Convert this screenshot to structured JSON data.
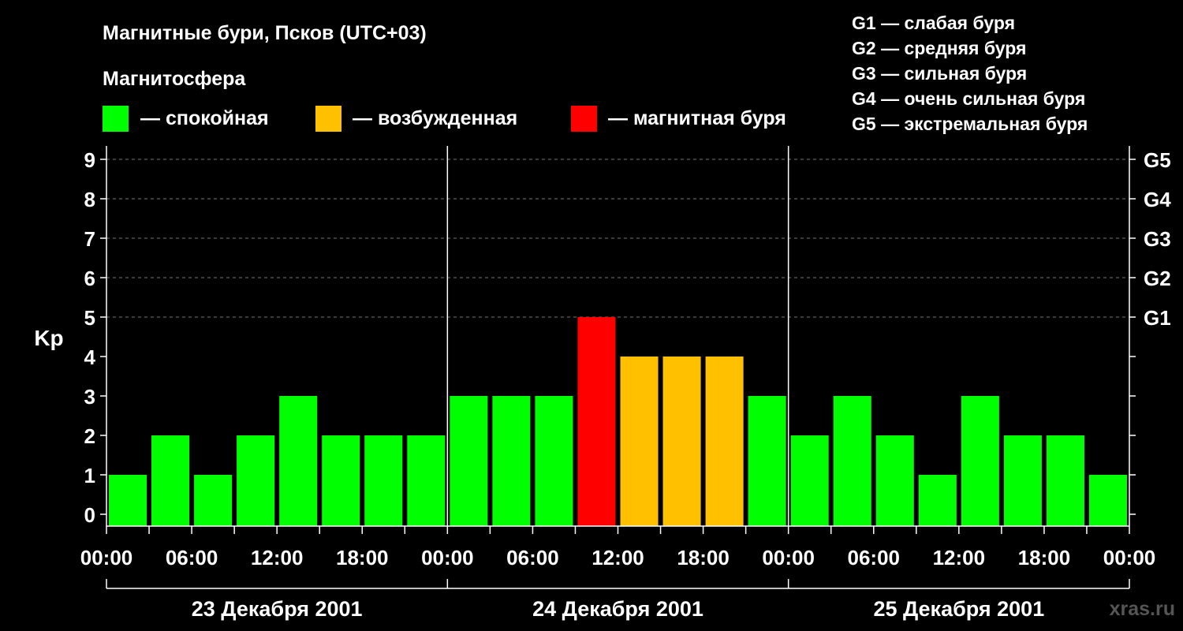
{
  "header": {
    "title": "Магнитные бури, Псков (UTC+03)",
    "magnetosphere_label": "Магнитосфера",
    "legend": [
      {
        "label": "— спокойная",
        "color": "#00ff00"
      },
      {
        "label": "— возбужденная",
        "color": "#ffc000"
      },
      {
        "label": "— магнитная буря",
        "color": "#ff0000"
      }
    ],
    "g_scale": [
      "G1 — слабая буря",
      "G2 — средняя буря",
      "G3 — сильная буря",
      "G4 — очень сильная буря",
      "G5 — экстремальная буря"
    ]
  },
  "watermark": "xras.ru",
  "chart_data": {
    "type": "bar",
    "ylabel": "Kp",
    "ylim": [
      0,
      9
    ],
    "y_ticks": [
      "0",
      "1",
      "2",
      "3",
      "4",
      "5",
      "6",
      "7",
      "8",
      "9"
    ],
    "right_ticks": [
      {
        "kp": 5,
        "label": "G1"
      },
      {
        "kp": 6,
        "label": "G2"
      },
      {
        "kp": 7,
        "label": "G3"
      },
      {
        "kp": 8,
        "label": "G4"
      },
      {
        "kp": 9,
        "label": "G5"
      }
    ],
    "x_tick_labels": [
      "00:00",
      "06:00",
      "12:00",
      "18:00",
      "00:00",
      "06:00",
      "12:00",
      "18:00",
      "00:00",
      "06:00",
      "12:00",
      "18:00",
      "00:00"
    ],
    "days": [
      "23 Декабря 2001",
      "24 Декабря 2001",
      "25 Декабря 2001"
    ],
    "interval_hours": 3,
    "values": [
      1,
      2,
      1,
      2,
      3,
      2,
      2,
      2,
      3,
      3,
      3,
      5,
      4,
      4,
      4,
      3,
      2,
      3,
      2,
      1,
      3,
      2,
      2,
      1
    ],
    "color_thresholds": {
      "quiet_max": 3,
      "active": 4,
      "storm_min": 5
    },
    "grid": "dashed horizontal at G levels"
  }
}
